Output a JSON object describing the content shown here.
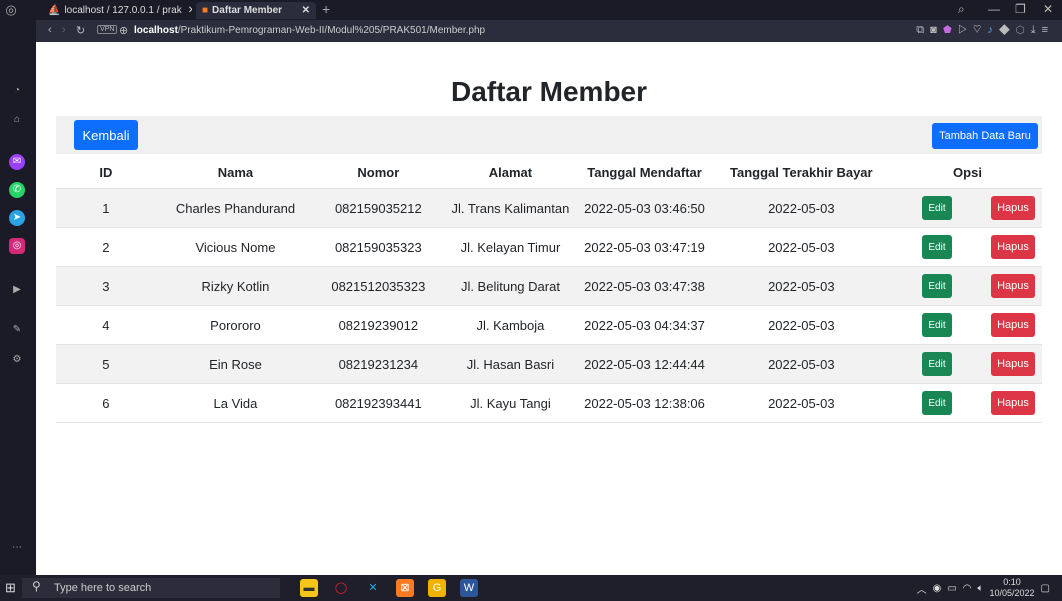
{
  "browser": {
    "tabs": [
      {
        "label": "localhost / 127.0.0.1 / prak",
        "icon": "phpmyadmin-icon"
      },
      {
        "label": "Daftar Member",
        "icon": "xampp-icon"
      }
    ],
    "url_host": "localhost",
    "url_path": "/Praktikum-Pemrograman-Web-II/Modul%205/PRAK501/Member.php",
    "vpn_label": "VPN"
  },
  "page": {
    "title": "Daftar Member",
    "back_label": "Kembali",
    "add_label": "Tambah Data Baru",
    "edit_label": "Edit",
    "delete_label": "Hapus"
  },
  "table": {
    "headers": [
      "ID",
      "Nama",
      "Nomor",
      "Alamat",
      "Tanggal Mendaftar",
      "Tanggal Terakhir Bayar",
      "Opsi"
    ],
    "rows": [
      [
        "1",
        "Charles Phandurand",
        "082159035212",
        "Jl. Trans Kalimantan",
        "2022-05-03 03:46:50",
        "2022-05-03"
      ],
      [
        "2",
        "Vicious Nome",
        "082159035323",
        "Jl. Kelayan Timur",
        "2022-05-03 03:47:19",
        "2022-05-03"
      ],
      [
        "3",
        "Rizky Kotlin",
        "0821512035323",
        "Jl. Belitung Darat",
        "2022-05-03 03:47:38",
        "2022-05-03"
      ],
      [
        "4",
        "Porororo",
        "08219239012",
        "Jl. Kamboja",
        "2022-05-03 04:34:37",
        "2022-05-03"
      ],
      [
        "5",
        "Ein Rose",
        "08219231234",
        "Jl. Hasan Basri",
        "2022-05-03 12:44:44",
        "2022-05-03"
      ],
      [
        "6",
        "La Vida",
        "082192393441",
        "Jl. Kayu Tangi",
        "2022-05-03 12:38:06",
        "2022-05-03"
      ]
    ]
  },
  "taskbar": {
    "search_placeholder": "Type here to search",
    "time": "0:10",
    "date": "10/05/2022"
  },
  "colors": {
    "primary": "#0d6efd",
    "success": "#198754",
    "danger": "#dc3545"
  }
}
